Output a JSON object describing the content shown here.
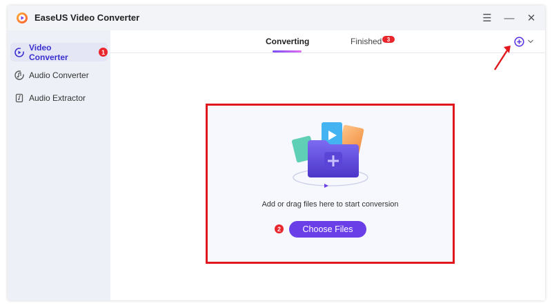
{
  "app": {
    "title": "EaseUS Video Converter",
    "accent": "#6a3fe8",
    "highlight": "#e0181e"
  },
  "window_controls": [
    {
      "icon": "menu-icon",
      "glyph": "☰"
    },
    {
      "icon": "minimize-icon",
      "glyph": "—"
    },
    {
      "icon": "close-icon",
      "glyph": "✕"
    }
  ],
  "sidebar": {
    "items": [
      {
        "label": "Video Converter",
        "icon": "video-converter-icon",
        "active": true,
        "step": "1"
      },
      {
        "label": "Audio Converter",
        "icon": "audio-converter-icon",
        "active": false
      },
      {
        "label": "Audio Extractor",
        "icon": "audio-extractor-icon",
        "active": false
      }
    ]
  },
  "tabs": {
    "converting": "Converting",
    "finished": "Finished",
    "finished_count": "3"
  },
  "drop_zone": {
    "hint": "Add or drag files here to start conversion",
    "button": "Choose Files",
    "step": "2"
  }
}
